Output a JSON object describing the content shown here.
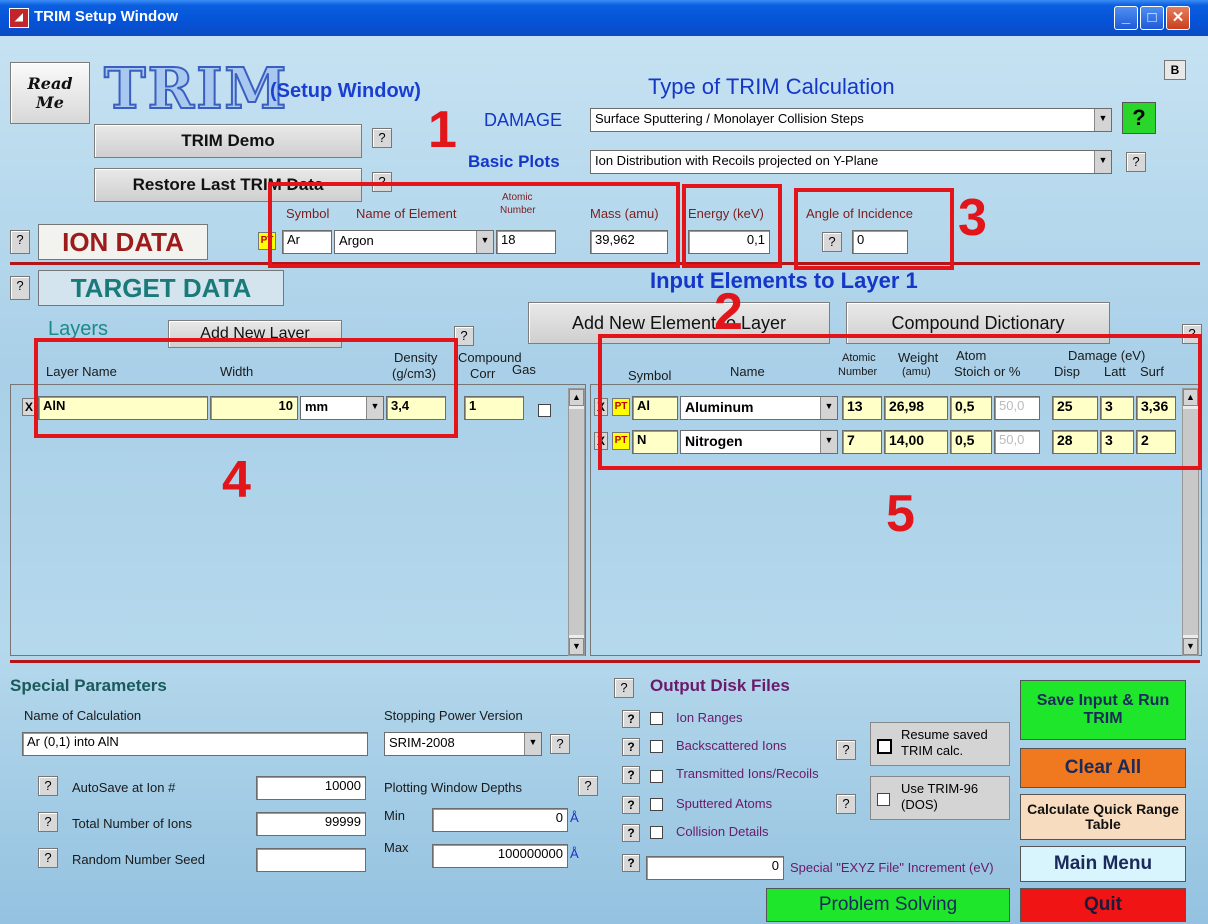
{
  "window": {
    "title": "TRIM Setup Window"
  },
  "header": {
    "readme_label": "Read Me",
    "logo": "TRIM",
    "subtitle": "(Setup Window)",
    "b_label": "B",
    "demo_label": "TRIM Demo",
    "restore_label": "Restore Last TRIM Data",
    "help": "?"
  },
  "calc": {
    "heading": "Type of TRIM Calculation",
    "damage_label": "DAMAGE",
    "damage_value": "Surface Sputtering / Monolayer Collision Steps",
    "plots_label": "Basic Plots",
    "plots_value": "Ion Distribution with Recoils projected on Y-Plane"
  },
  "ion": {
    "title": "ION DATA",
    "h_symbol": "Symbol",
    "h_name": "Name of Element",
    "h_atomic1": "Atomic",
    "h_atomic2": "Number",
    "h_mass": "Mass (amu)",
    "h_energy": "Energy (keV)",
    "h_angle": "Angle of Incidence",
    "pt": "PT",
    "symbol": "Ar",
    "name": "Argon",
    "atomic_number": "18",
    "mass": "39,962",
    "energy": "0,1",
    "angle": "0"
  },
  "target": {
    "title": "TARGET DATA",
    "layers_label": "Layers",
    "add_layer": "Add New Layer",
    "input_elements": "Input Elements to Layer 1",
    "add_element": "Add New Element to Layer",
    "compound_dict": "Compound Dictionary",
    "h_layer_name": "Layer Name",
    "h_width": "Width",
    "h_density1": "Density",
    "h_density2": "(g/cm3)",
    "h_compound1": "Compound",
    "h_compound2": "Corr",
    "h_gas": "Gas",
    "layer": {
      "x": "X",
      "name": "AlN",
      "width": "10",
      "unit": "mm",
      "density": "3,4",
      "corr": "1"
    },
    "h_symbol": "Symbol",
    "h_name": "Name",
    "h_atomic1": "Atomic",
    "h_atomic2": "Number",
    "h_weight1": "Weight",
    "h_weight2": "(amu)",
    "h_atom1": "Atom",
    "h_atom2": "Stoich or %",
    "h_damage": "Damage (eV)",
    "h_disp": "Disp",
    "h_latt": "Latt",
    "h_surf": "Surf",
    "elements": [
      {
        "x": "X",
        "pt": "PT",
        "symbol": "Al",
        "name": "Aluminum",
        "atomic": "13",
        "weight": "26,98",
        "stoich": "0,5",
        "pct": "50,0",
        "disp": "25",
        "latt": "3",
        "surf": "3,36"
      },
      {
        "x": "X",
        "pt": "PT",
        "symbol": "N",
        "name": "Nitrogen",
        "atomic": "7",
        "weight": "14,00",
        "stoich": "0,5",
        "pct": "50,0",
        "disp": "28",
        "latt": "3",
        "surf": "2"
      }
    ]
  },
  "annotations": [
    "1",
    "2",
    "3",
    "4",
    "5"
  ],
  "special": {
    "title": "Special Parameters",
    "calc_name_label": "Name of Calculation",
    "calc_name": "Ar (0,1) into AlN",
    "stopping_label": "Stopping Power Version",
    "stopping_value": "SRIM-2008",
    "autosave_label": "AutoSave at Ion #",
    "autosave": "10000",
    "total_label": "Total Number of Ions",
    "total": "99999",
    "seed_label": "Random Number Seed",
    "seed": "",
    "plot_depths_label": "Plotting Window Depths",
    "min_label": "Min",
    "min": "0",
    "max_label": "Max",
    "max": "100000000",
    "unit": "Å"
  },
  "output": {
    "title": "Output Disk Files",
    "items": [
      "Ion Ranges",
      "Backscattered Ions",
      "Transmitted Ions/Recoils",
      "Sputtered Atoms",
      "Collision Details"
    ],
    "exyz_value": "0",
    "exyz_label": "Special \"EXYZ File\" Increment (eV)",
    "resume": "Resume saved TRIM calc.",
    "trim96": "Use TRIM-96 (DOS)"
  },
  "actions": {
    "save": "Save Input & Run TRIM",
    "clear": "Clear All",
    "quick": "Calculate Quick Range Table",
    "main": "Main Menu",
    "quit": "Quit",
    "problem": "Problem Solving"
  },
  "colors": {
    "save": "#1ee62a",
    "clear": "#f0781e",
    "quick": "#f8dcc0",
    "main": "#d8f4fc",
    "quit": "#f01414",
    "problem": "#1ee62a",
    "accent_red": "#e1151a"
  }
}
